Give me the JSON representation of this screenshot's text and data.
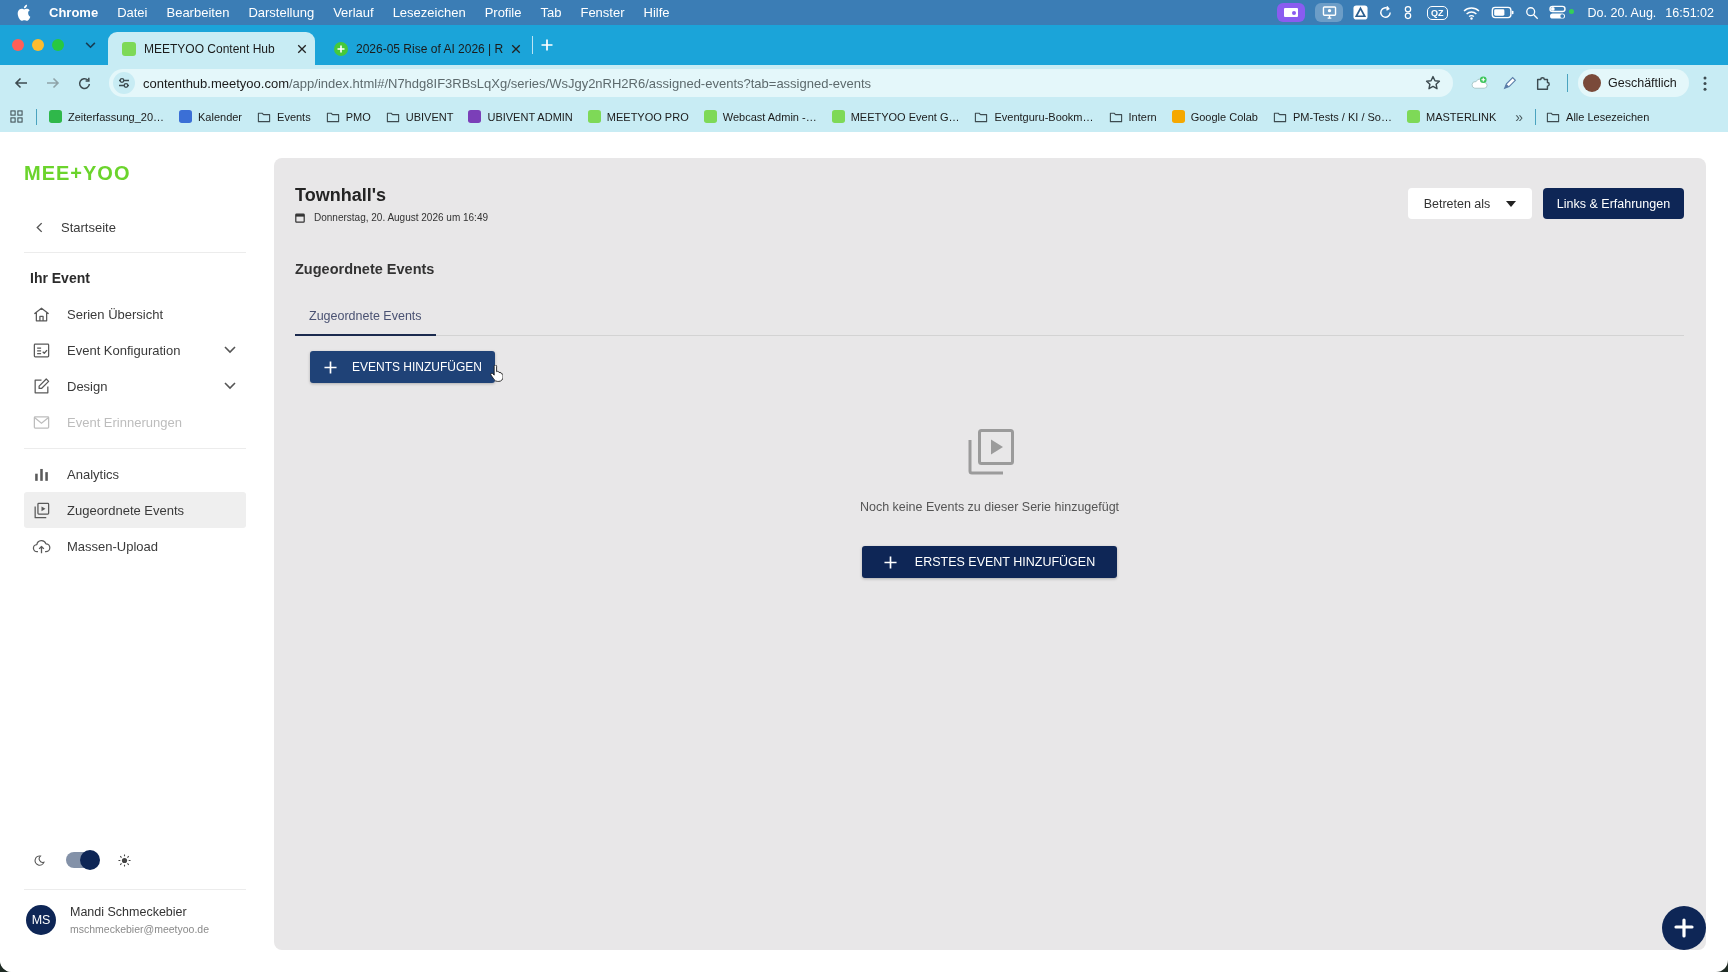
{
  "menu_bar": {
    "app": "Chrome",
    "items": [
      "Datei",
      "Bearbeiten",
      "Darstellung",
      "Verlauf",
      "Lesezeichen",
      "Profile",
      "Tab",
      "Fenster",
      "Hilfe"
    ],
    "status_badge": "QZ",
    "date": "Do. 20. Aug.",
    "time": "16:51:02"
  },
  "browser": {
    "tabs": [
      {
        "title": "MEETYOO Content Hub",
        "selected": true
      },
      {
        "title": "2026-05 Rise of AI 2026 | R",
        "selected": false
      }
    ],
    "url": {
      "host": "contenthub.meetyoo.com",
      "path": "/app/index.html#/N7hdg8IF3RBsLqXg/series/WsJgy2nRH2R6/assigned-events?tab=assigned-events"
    },
    "profile": "Geschäftlich",
    "bookmarks": [
      {
        "label": "Zeiterfassung_20…",
        "kind": "site",
        "color": "#2fb84a"
      },
      {
        "label": "Kalender",
        "kind": "site",
        "color": "#3b6fd6"
      },
      {
        "label": "Events",
        "kind": "folder"
      },
      {
        "label": "PMO",
        "kind": "folder"
      },
      {
        "label": "UBIVENT",
        "kind": "folder"
      },
      {
        "label": "UBIVENT ADMIN",
        "kind": "site",
        "color": "#7b3fb8"
      },
      {
        "label": "MEETYOO PRO",
        "kind": "site",
        "color": "#7ed957"
      },
      {
        "label": "Webcast Admin -…",
        "kind": "site",
        "color": "#7ed957"
      },
      {
        "label": "MEETYOO Event G…",
        "kind": "site",
        "color": "#7ed957"
      },
      {
        "label": "Eventguru-Bookm…",
        "kind": "folder"
      },
      {
        "label": "Intern",
        "kind": "folder"
      },
      {
        "label": "Google Colab",
        "kind": "site",
        "color": "#f5a800"
      },
      {
        "label": "PM-Tests / KI / So…",
        "kind": "folder"
      },
      {
        "label": "MASTERLINK",
        "kind": "site",
        "color": "#7ed957"
      }
    ],
    "overflow": "»",
    "all_bookmarks": "Alle Lesezeichen"
  },
  "sidebar": {
    "logo": "MEE+YOO",
    "back": "Startseite",
    "section_title": "Ihr Event",
    "item_groups": [
      {
        "items": [
          {
            "label": "Serien Übersicht",
            "kind": "link",
            "selected": false,
            "disabled": false
          },
          {
            "label": "Event Konfiguration",
            "kind": "group",
            "expanded": false,
            "selected": false,
            "disabled": false
          },
          {
            "label": "Design",
            "kind": "group",
            "expanded": false,
            "selected": false,
            "disabled": false
          },
          {
            "label": "Event Erinnerungen",
            "kind": "link",
            "selected": false,
            "disabled": true
          }
        ]
      },
      {
        "items": [
          {
            "label": "Analytics",
            "kind": "link",
            "selected": false,
            "disabled": false
          },
          {
            "label": "Zugeordnete Events",
            "kind": "link",
            "selected": true,
            "disabled": false
          },
          {
            "label": "Massen-Upload",
            "kind": "link",
            "selected": false,
            "disabled": false
          }
        ]
      }
    ],
    "theme_switch": {
      "on": true
    },
    "user": {
      "initials": "MS",
      "name": "Mandi Schmeckebier",
      "email": "mschmeckebier@meetyoo.de"
    }
  },
  "main": {
    "title": "Townhall's",
    "date": "Donnerstag, 20. August 2026 um 16:49",
    "actions": [
      {
        "label": "Betreten als",
        "kind": "dropdown"
      },
      {
        "label": "Links & Erfahrungen",
        "kind": "primary"
      }
    ],
    "section_title": "Zugeordnete Events",
    "tabs": [
      {
        "label": "Zugeordnete Events",
        "selected": true
      }
    ],
    "add_button": {
      "label": "EVENTS HINZUFÜGEN",
      "hovered": true
    },
    "empty_state": {
      "message": "Noch keine Events zu dieser Serie hinzugefügt",
      "button": "ERSTES EVENT HINZUFÜGEN"
    }
  }
}
